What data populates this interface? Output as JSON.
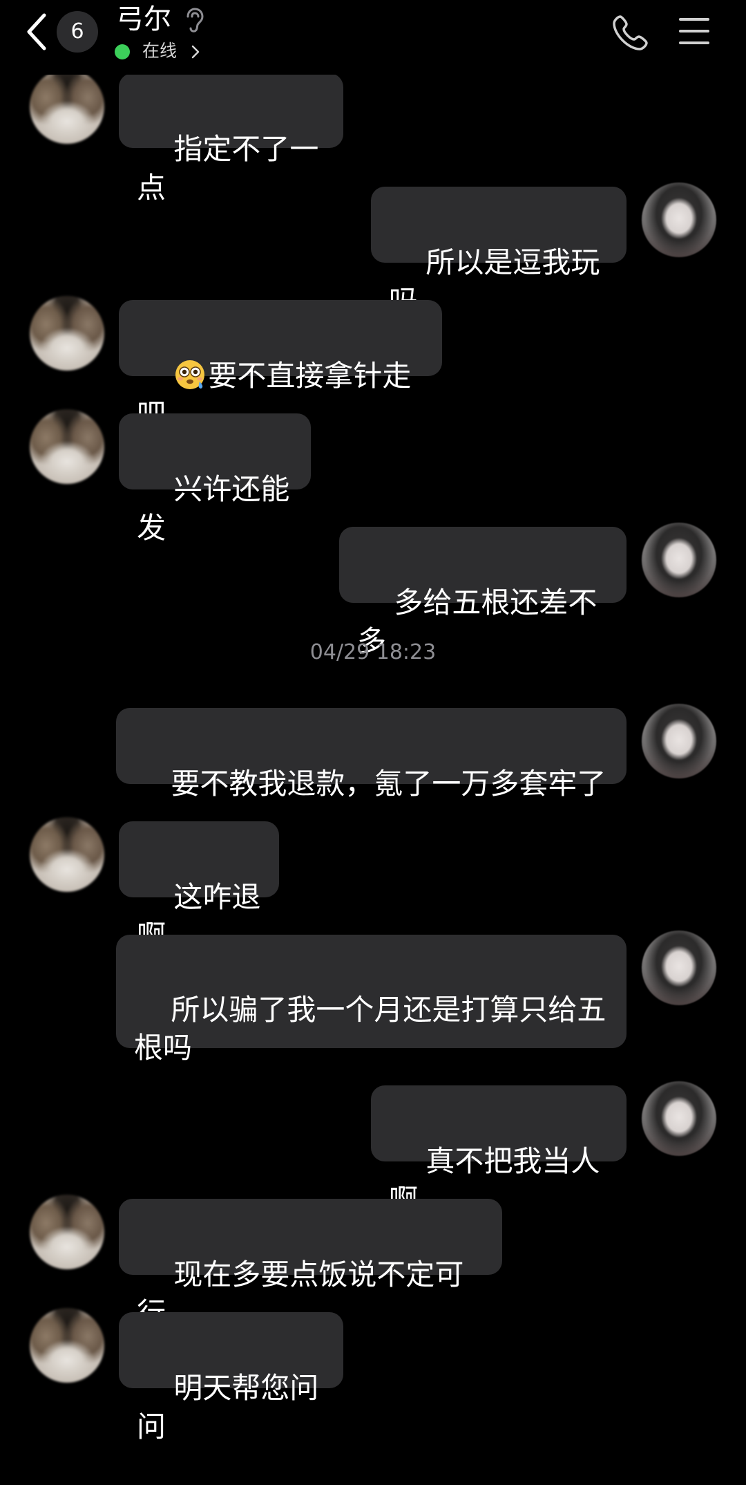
{
  "header": {
    "unread_count": "6",
    "contact_name": "弓尔",
    "status_text": "在线",
    "status_color": "#3ccf5a",
    "icons": [
      "back-chevron-icon",
      "ear-icon",
      "chevron-right-icon",
      "phone-icon",
      "menu-icon"
    ]
  },
  "timestamp": "04/29 18:23",
  "messages": [
    {
      "side": "left",
      "text": "指定不了一点"
    },
    {
      "side": "right",
      "text": "所以是逗我玩吗"
    },
    {
      "side": "left",
      "emoji": "flushed-face-emoji",
      "text": "要不直接拿针走吧"
    },
    {
      "side": "left",
      "text": "兴许还能发"
    },
    {
      "side": "right",
      "text": "多给五根还差不多"
    },
    {
      "side": "right",
      "text": "要不教我退款，氪了一万多套牢了"
    },
    {
      "side": "left",
      "text": "这咋退啊"
    },
    {
      "side": "right",
      "text": "所以骗了我一个月还是打算只给五根吗"
    },
    {
      "side": "right",
      "text": "真不把我当人啊"
    },
    {
      "side": "left",
      "text": "现在多要点饭说不定可行"
    },
    {
      "side": "left",
      "text": "明天帮您问问"
    }
  ],
  "colors": {
    "background": "#000000",
    "bubble": "#2d2d2f",
    "text": "#ffffff",
    "timestamp": "#8e8e93"
  }
}
